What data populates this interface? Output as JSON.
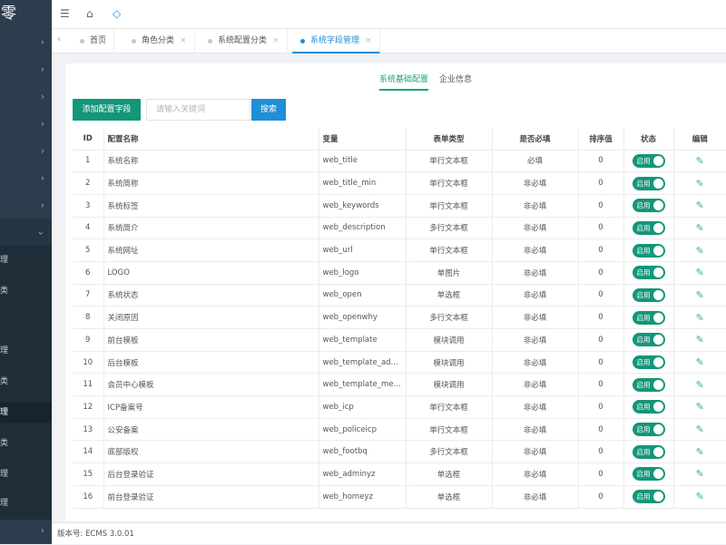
{
  "sidebar": {
    "logo": "零",
    "submenu_items": [
      "理",
      "类",
      "",
      "理",
      "类",
      "理",
      "类",
      "理",
      "理"
    ],
    "active_index": 5
  },
  "tabs": [
    {
      "label": "首页",
      "active": false
    },
    {
      "label": "角色分类",
      "active": false
    },
    {
      "label": "系统配置分类",
      "active": false
    },
    {
      "label": "系统字段管理",
      "active": true
    }
  ],
  "subtabs": {
    "basic": "系统基础配置",
    "company": "企业信息"
  },
  "toolbar": {
    "add_label": "添加配置字段",
    "search_placeholder": "请输入关键词",
    "search_label": "搜索"
  },
  "table": {
    "headers": [
      "ID",
      "配置名称",
      "变量",
      "表单类型",
      "是否必填",
      "排序值",
      "状态",
      "编辑"
    ],
    "status_label": "启用",
    "rows": [
      {
        "id": "1",
        "name": "系统名称",
        "var": "web_title",
        "type": "单行文本框",
        "required": "必填",
        "sort": "0"
      },
      {
        "id": "2",
        "name": "系统简称",
        "var": "web_title_min",
        "type": "单行文本框",
        "required": "非必填",
        "sort": "0"
      },
      {
        "id": "3",
        "name": "系统标签",
        "var": "web_keywords",
        "type": "单行文本框",
        "required": "非必填",
        "sort": "0"
      },
      {
        "id": "4",
        "name": "系统简介",
        "var": "web_description",
        "type": "多行文本框",
        "required": "非必填",
        "sort": "0"
      },
      {
        "id": "5",
        "name": "系统网址",
        "var": "web_url",
        "type": "单行文本框",
        "required": "非必填",
        "sort": "0"
      },
      {
        "id": "6",
        "name": "LOGO",
        "var": "web_logo",
        "type": "单图片",
        "required": "非必填",
        "sort": "0"
      },
      {
        "id": "7",
        "name": "系统状态",
        "var": "web_open",
        "type": "单选框",
        "required": "非必填",
        "sort": "0"
      },
      {
        "id": "8",
        "name": "关闭原因",
        "var": "web_openwhy",
        "type": "多行文本框",
        "required": "非必填",
        "sort": "0"
      },
      {
        "id": "9",
        "name": "前台模板",
        "var": "web_template",
        "type": "模块调用",
        "required": "非必填",
        "sort": "0"
      },
      {
        "id": "10",
        "name": "后台模板",
        "var": "web_template_ad...",
        "type": "模块调用",
        "required": "非必填",
        "sort": "0"
      },
      {
        "id": "11",
        "name": "会员中心模板",
        "var": "web_template_me...",
        "type": "模块调用",
        "required": "非必填",
        "sort": "0"
      },
      {
        "id": "12",
        "name": "ICP备案号",
        "var": "web_icp",
        "type": "单行文本框",
        "required": "非必填",
        "sort": "0"
      },
      {
        "id": "13",
        "name": "公安备案",
        "var": "web_policeicp",
        "type": "单行文本框",
        "required": "非必填",
        "sort": "0"
      },
      {
        "id": "14",
        "name": "底部版权",
        "var": "web_footbq",
        "type": "多行文本框",
        "required": "非必填",
        "sort": "0"
      },
      {
        "id": "15",
        "name": "后台登录验证",
        "var": "web_adminyz",
        "type": "单选框",
        "required": "非必填",
        "sort": "0"
      },
      {
        "id": "16",
        "name": "前台登录验证",
        "var": "web_homeyz",
        "type": "单选框",
        "required": "非必填",
        "sort": "0"
      }
    ]
  },
  "footer": {
    "version": "版本号: ECMS 3.0.01"
  },
  "colors": {
    "sidebar_bg": "#2c3e4d",
    "accent_green": "#149679",
    "accent_blue": "#1e8fd8"
  }
}
